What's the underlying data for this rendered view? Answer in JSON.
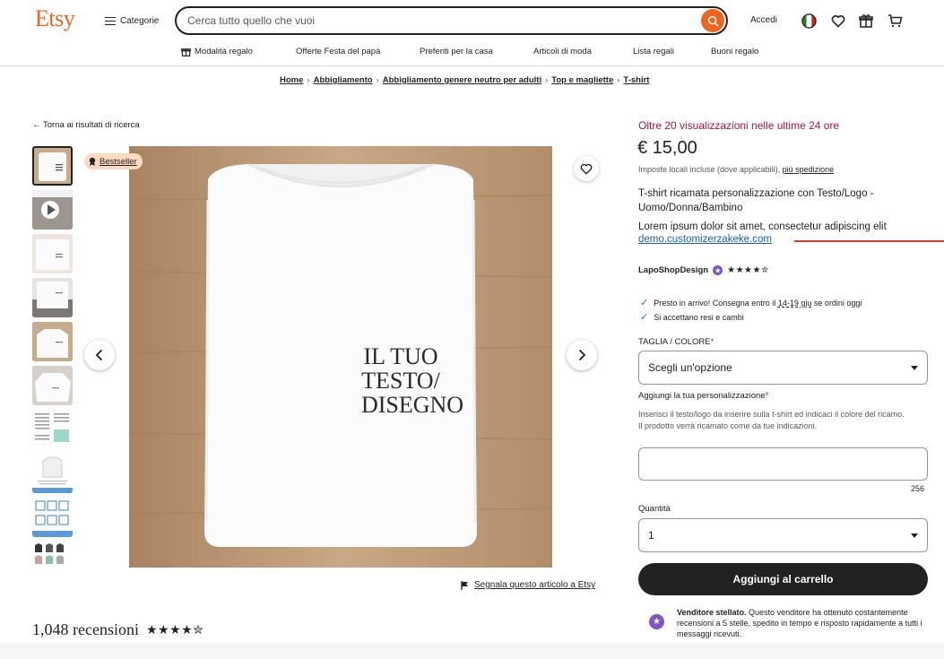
{
  "header": {
    "logo": "Etsy",
    "categories_label": "Categorie",
    "search_placeholder": "Cerca tutto quello che vuoi",
    "signin_label": "Accedi",
    "icons": [
      "search-icon",
      "italy-flag-icon",
      "heart-icon",
      "gift-icon",
      "cart-icon"
    ]
  },
  "nav": {
    "items": [
      {
        "label": "Modalità regalo",
        "icon": "gift-icon"
      },
      {
        "label": "Offerte Festa del papà"
      },
      {
        "label": "Preferiti per la casa"
      },
      {
        "label": "Articoli di moda"
      },
      {
        "label": "Lista regali"
      },
      {
        "label": "Buoni regalo"
      }
    ]
  },
  "breadcrumb": [
    "Home",
    "Abbigliamento",
    "Abbigliamento genere neutro per adulti",
    "Top e magliette",
    "T-shirt"
  ],
  "back_link": "← Torna ai risultati di ricerca",
  "gallery": {
    "badge": "Bestseller",
    "image_text": [
      "IL TUO",
      "TESTO/",
      "DISEGNO"
    ],
    "thumbnail_count": 10,
    "active_index": 0
  },
  "report_link": "Segnala questo articolo a Etsy",
  "reviews": {
    "count_label": "1,048 recensioni",
    "stars": "★★★★✮"
  },
  "product": {
    "views_note": "Oltre 20 visualizzazioni nelle ultime 24 ore",
    "price": "€ 15,00",
    "tax_note": "Imposte locali incluse (dove applicabili),",
    "tax_link": "più spedizione",
    "title": "T-shirt ricamata personalizzazione con Testo/Logo - Uomo/Donna/Bambino",
    "lorem": "Lorem ipsum dolor sit amet, consectetur adipiscing elit",
    "demo_link": "demo.customizerzakeke.com",
    "shop_name": "LapoShopDesign",
    "shop_stars": "★★★★✮",
    "shipping_prefix": "Presto in arrivo! Consegna entro il",
    "shipping_dates": "14-19 giu",
    "shipping_suffix": "se ordini oggi",
    "returns": "Si accettano resi e cambi",
    "size_label": "TAGLIA / COLORE",
    "size_value": "Scegli un'opzione",
    "personalization_label": "Aggiungi la tua personalizzazione",
    "personalization_help_1": "Inserisci il testo/logo da inserire sulla t-shirt ed indicaci il colore del ricamo.",
    "personalization_help_2": "Il prodotto verrà ricamato come da tue indicazioni.",
    "char_counter": "256",
    "quantity_label": "Quantità",
    "quantity_value": "1",
    "add_to_cart": "Aggiungi al carrello",
    "star_seller_title": "Venditore stellato.",
    "star_seller_text": "Questo venditore ha ottenuto costantemente recensioni a 5 stelle, spedito in tempo e risposto rapidamente a tutti i messaggi ricevuti."
  },
  "colors": {
    "brand": "#f1641e",
    "urgency": "#b1133d",
    "star_seller": "#7f55c3",
    "button_dark": "#222222"
  }
}
